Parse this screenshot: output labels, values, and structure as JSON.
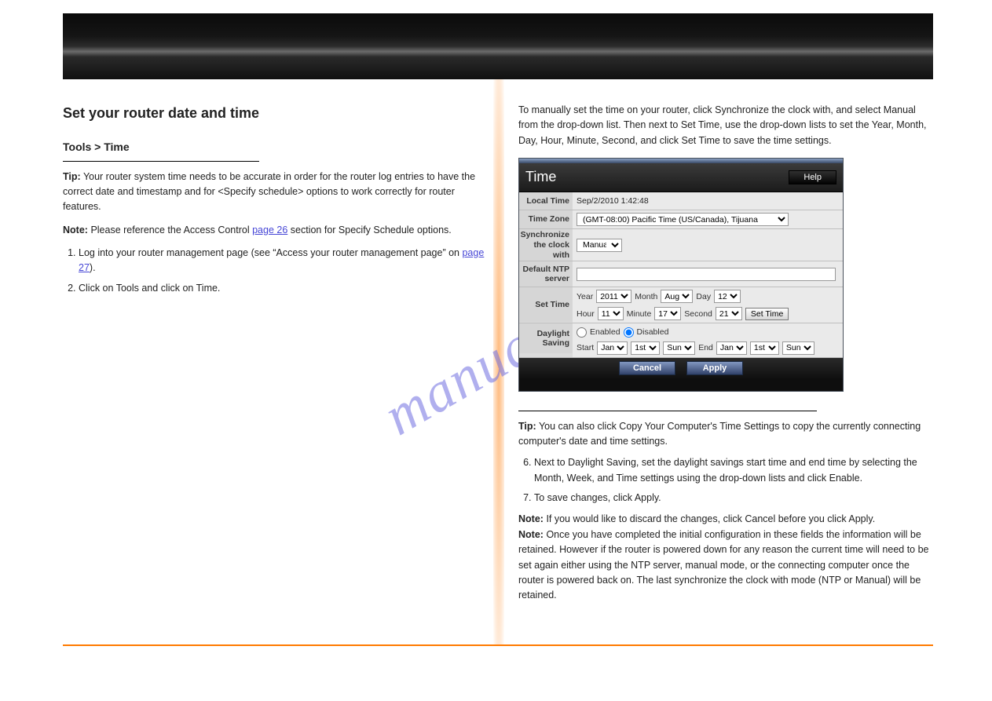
{
  "left": {
    "h2": "Set your router date and time",
    "sub": "Tools > Time",
    "tip_label": "Tip:",
    "tip_text": "Your router system time needs to be accurate in order for the router log entries to have the correct date and timestamp and for <Specify schedule> options to work correctly for router features.",
    "note_label": "Note:",
    "note_text": "Please reference the Access Control page 26 section for Specify Schedule options.",
    "access_link": "page 26",
    "steps": [
      "Log into your router management page (see \"Access your router management page\" on page 27).",
      "Click on Tools and click on Time."
    ],
    "mgmt_link": "page 27"
  },
  "right": {
    "lead": "To manually set the time on your router, click Synchronize the clock with, and select Manual from the drop-down list. Then next to Set Time, use the drop-down lists to set the Year, Month, Day, Hour, Minute, Second, and click Set Time to save the time settings.",
    "tip_label": "Tip:",
    "tip_text": "You can also click Copy Your Computer's Time Settings to copy the currently connecting computer's date and time settings.",
    "steps_post": [
      "Next to Daylight Saving, set the daylight savings start time and end time by selecting the Month, Week, and Time settings using the drop-down lists and click Enable.",
      "To save changes, click Apply."
    ],
    "note_label": "Note:",
    "note_text": "If you would like to discard the changes, click Cancel before you click Apply.",
    "note2": "Once you have completed the initial configuration in these fields the information will be retained. However if the router is powered down for any reason the current time will need to be set again either using the NTP server, manual mode, or the connecting computer once the router is powered back on. The last synchronize the clock with mode (NTP or Manual) will be retained."
  },
  "shot": {
    "title": "Time",
    "help": "Help",
    "rows": {
      "local_time_label": "Local Time",
      "local_time_value": "Sep/2/2010 1:42:48",
      "tz_label": "Time Zone",
      "tz_value": "(GMT-08:00) Pacific Time (US/Canada), Tijuana",
      "sync_label": "Synchronize the clock with",
      "sync_value": "Manual",
      "ntp_label": "Default NTP server",
      "ntp_value": "",
      "settime_label": "Set Time",
      "year_label": "Year",
      "year_value": "2011",
      "month_label": "Month",
      "month_value": "Aug",
      "day_label": "Day",
      "day_value": "12",
      "hour_label": "Hour",
      "hour_value": "11",
      "minute_label": "Minute",
      "minute_value": "17",
      "second_label": "Second",
      "second_value": "21",
      "set_time_btn": "Set Time",
      "ds_label": "Daylight Saving",
      "enabled": "Enabled",
      "disabled": "Disabled",
      "start_label": "Start",
      "end_label": "End",
      "ds_month_a": "Jan",
      "ds_week_a": "1st",
      "ds_day_a": "Sun",
      "ds_month_b": "Jan",
      "ds_week_b": "1st",
      "ds_day_b": "Sun"
    },
    "footer": {
      "cancel": "Cancel",
      "apply": "Apply"
    }
  },
  "watermark": "manualshive.com"
}
